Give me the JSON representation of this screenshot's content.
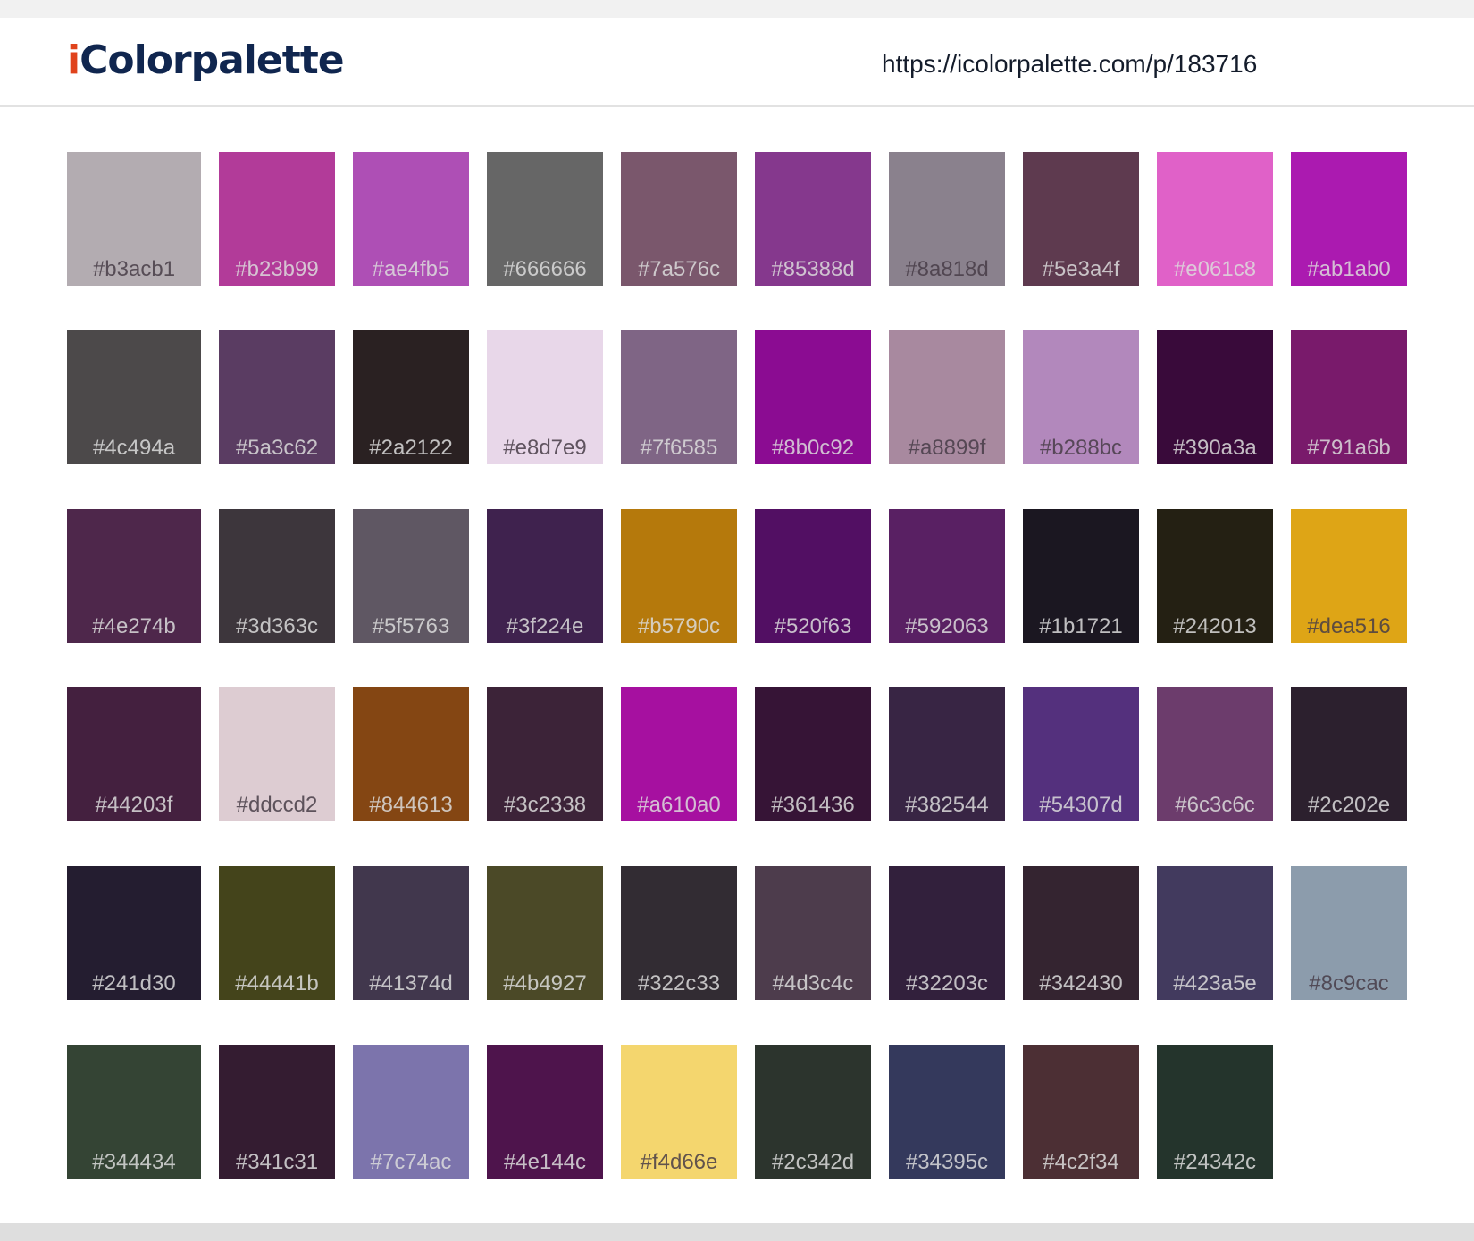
{
  "header": {
    "logo_i": "i",
    "logo_rest": "Colorpalette",
    "url": "https://icolorpalette.com/p/183716"
  },
  "swatches": [
    {
      "hex": "#b3acb1",
      "light": true
    },
    {
      "hex": "#b23b99",
      "light": false
    },
    {
      "hex": "#ae4fb5",
      "light": false
    },
    {
      "hex": "#666666",
      "light": false
    },
    {
      "hex": "#7a576c",
      "light": false
    },
    {
      "hex": "#85388d",
      "light": false
    },
    {
      "hex": "#8a818d",
      "light": true
    },
    {
      "hex": "#5e3a4f",
      "light": false
    },
    {
      "hex": "#e061c8",
      "light": false
    },
    {
      "hex": "#ab1ab0",
      "light": false
    },
    {
      "hex": "#4c494a",
      "light": false
    },
    {
      "hex": "#5a3c62",
      "light": false
    },
    {
      "hex": "#2a2122",
      "light": false
    },
    {
      "hex": "#e8d7e9",
      "light": true
    },
    {
      "hex": "#7f6585",
      "light": false
    },
    {
      "hex": "#8b0c92",
      "light": false
    },
    {
      "hex": "#a8899f",
      "light": true
    },
    {
      "hex": "#b288bc",
      "light": true
    },
    {
      "hex": "#390a3a",
      "light": false
    },
    {
      "hex": "#791a6b",
      "light": false
    },
    {
      "hex": "#4e274b",
      "light": false
    },
    {
      "hex": "#3d363c",
      "light": false
    },
    {
      "hex": "#5f5763",
      "light": false
    },
    {
      "hex": "#3f224e",
      "light": false
    },
    {
      "hex": "#b5790c",
      "light": false
    },
    {
      "hex": "#520f63",
      "light": false
    },
    {
      "hex": "#592063",
      "light": false
    },
    {
      "hex": "#1b1721",
      "light": false
    },
    {
      "hex": "#242013",
      "light": false
    },
    {
      "hex": "#dea516",
      "light": true
    },
    {
      "hex": "#44203f",
      "light": false
    },
    {
      "hex": "#ddccd2",
      "light": true
    },
    {
      "hex": "#844613",
      "light": false
    },
    {
      "hex": "#3c2338",
      "light": false
    },
    {
      "hex": "#a610a0",
      "light": false
    },
    {
      "hex": "#361436",
      "light": false
    },
    {
      "hex": "#382544",
      "light": false
    },
    {
      "hex": "#54307d",
      "light": false
    },
    {
      "hex": "#6c3c6c",
      "light": false
    },
    {
      "hex": "#2c202e",
      "light": false
    },
    {
      "hex": "#241d30",
      "light": false
    },
    {
      "hex": "#44441b",
      "light": false
    },
    {
      "hex": "#41374d",
      "light": false
    },
    {
      "hex": "#4b4927",
      "light": false
    },
    {
      "hex": "#322c33",
      "light": false
    },
    {
      "hex": "#4d3c4c",
      "light": false
    },
    {
      "hex": "#32203c",
      "light": false
    },
    {
      "hex": "#342430",
      "light": false
    },
    {
      "hex": "#423a5e",
      "light": false
    },
    {
      "hex": "#8c9cac",
      "light": true
    },
    {
      "hex": "#344434",
      "light": false
    },
    {
      "hex": "#341c31",
      "light": false
    },
    {
      "hex": "#7c74ac",
      "light": false
    },
    {
      "hex": "#4e144c",
      "light": false
    },
    {
      "hex": "#f4d66e",
      "light": true
    },
    {
      "hex": "#2c342d",
      "light": false
    },
    {
      "hex": "#34395c",
      "light": false
    },
    {
      "hex": "#4c2f34",
      "light": false
    },
    {
      "hex": "#24342c",
      "light": false
    }
  ]
}
